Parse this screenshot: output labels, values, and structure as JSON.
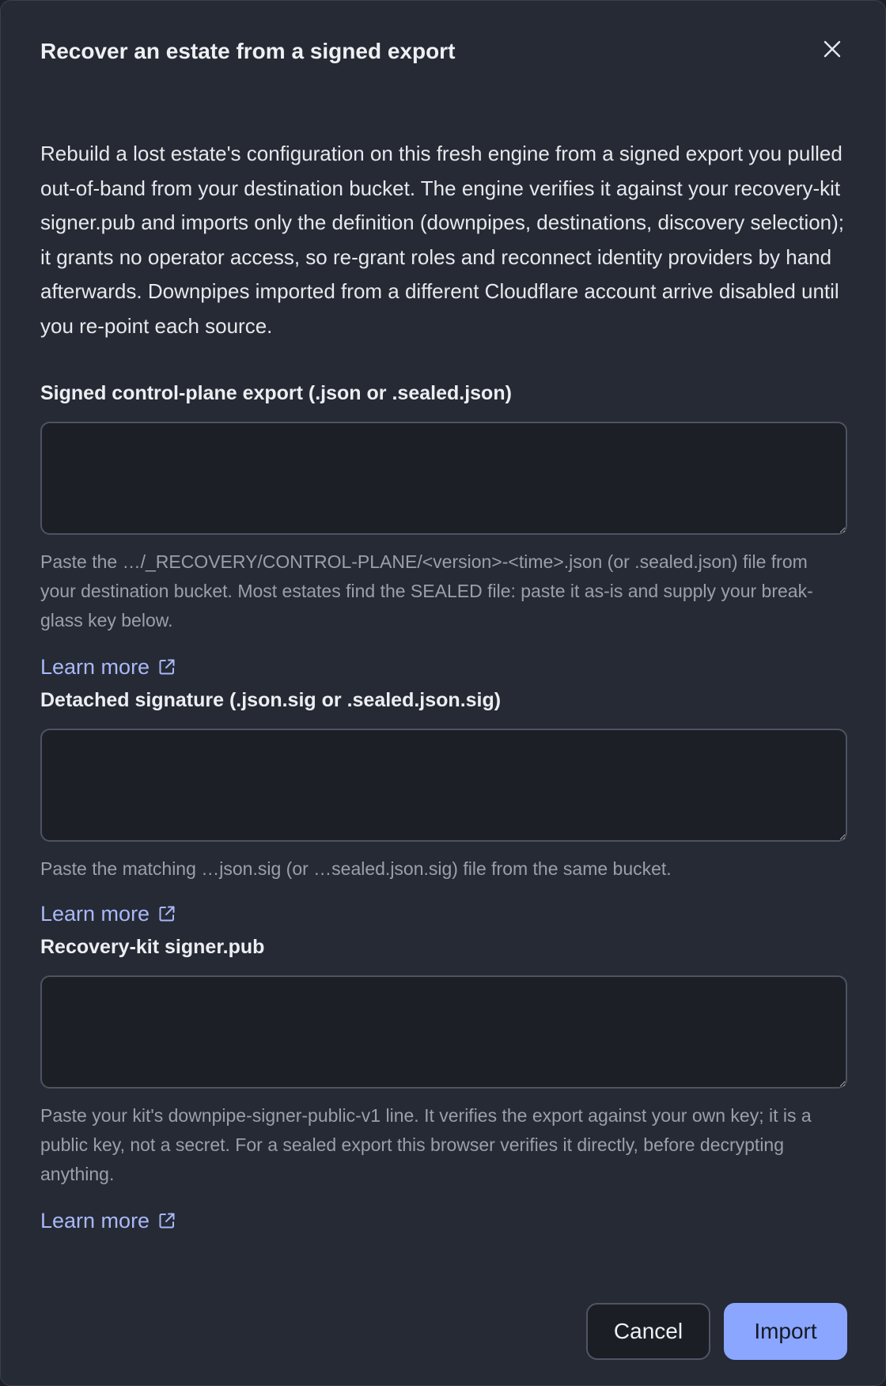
{
  "dialog": {
    "title": "Recover an estate from a signed export",
    "intro": "Rebuild a lost estate's configuration on this fresh engine from a signed export you pulled out-of-band from your destination bucket. The engine verifies it against your recovery-kit signer.pub and imports only the definition (downpipes, destinations, discovery selection); it grants no operator access, so re-grant roles and reconnect identity providers by hand afterwards. Downpipes imported from a different Cloudflare account arrive disabled until you re-point each source."
  },
  "fields": [
    {
      "label": "Signed control-plane export (.json or .sealed.json)",
      "value": "",
      "help": "Paste the …/_RECOVERY/CONTROL-PLANE/<version>-<time>.json (or .sealed.json) file from your destination bucket. Most estates find the SEALED file: paste it as-is and supply your break-glass key below.",
      "learn_more": "Learn more"
    },
    {
      "label": "Detached signature (.json.sig or .sealed.json.sig)",
      "value": "",
      "help": "Paste the matching …json.sig (or …sealed.json.sig) file from the same bucket.",
      "learn_more": "Learn more"
    },
    {
      "label": "Recovery-kit signer.pub",
      "value": "",
      "help": "Paste your kit's downpipe-signer-public-v1 line. It verifies the export against your own key; it is a public key, not a secret. For a sealed export this browser verifies it directly, before decrypting anything.",
      "learn_more": "Learn more"
    }
  ],
  "footer": {
    "cancel_label": "Cancel",
    "import_label": "Import"
  },
  "icons": {
    "close": "close-icon",
    "external_link": "external-link-icon"
  },
  "colors": {
    "dialog_bg": "#252a34",
    "field_bg": "#1c1f26",
    "link": "#a9b8f8",
    "primary_button": "#8aa6ff",
    "help_text": "#9aa0ab"
  }
}
